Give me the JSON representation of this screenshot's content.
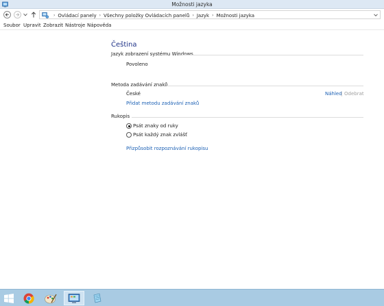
{
  "window": {
    "title": "Možnosti jazyka"
  },
  "address_bar": {
    "breadcrumbs": [
      "Ovládací panely",
      "Všechny položky Ovládacích panelů",
      "Jazyk",
      "Možnosti jazyka"
    ]
  },
  "menu": [
    "Soubor",
    "Upravit",
    "Zobrazit",
    "Nástroje",
    "Nápověda"
  ],
  "page": {
    "title": "Čeština",
    "display_language": {
      "heading": "Jazyk zobrazení systému Windows",
      "value": "Povoleno"
    },
    "input_method": {
      "heading": "Metoda zadávání znaků",
      "item": "České",
      "preview_link": "Náhled",
      "separator": "|",
      "remove_link": "Odebrat",
      "add_link": "Přidat metodu zadávání znaků"
    },
    "handwriting": {
      "heading": "Rukopis",
      "options": [
        "Psát znaky od ruky",
        "Psát každý znak zvlášť"
      ],
      "selected_index": 0,
      "customize_link": "Přizpůsobit rozpoznávání rukopisu"
    }
  },
  "taskbar": {
    "items": [
      "windows-logo",
      "chrome",
      "paint",
      "control-panel",
      "notepad"
    ],
    "active_index": 3
  },
  "colors": {
    "title_blue": "#1e3287",
    "link_blue": "#1a5fb4",
    "taskbar": "#a9cbe3",
    "titlebar": "#dde8f4"
  }
}
